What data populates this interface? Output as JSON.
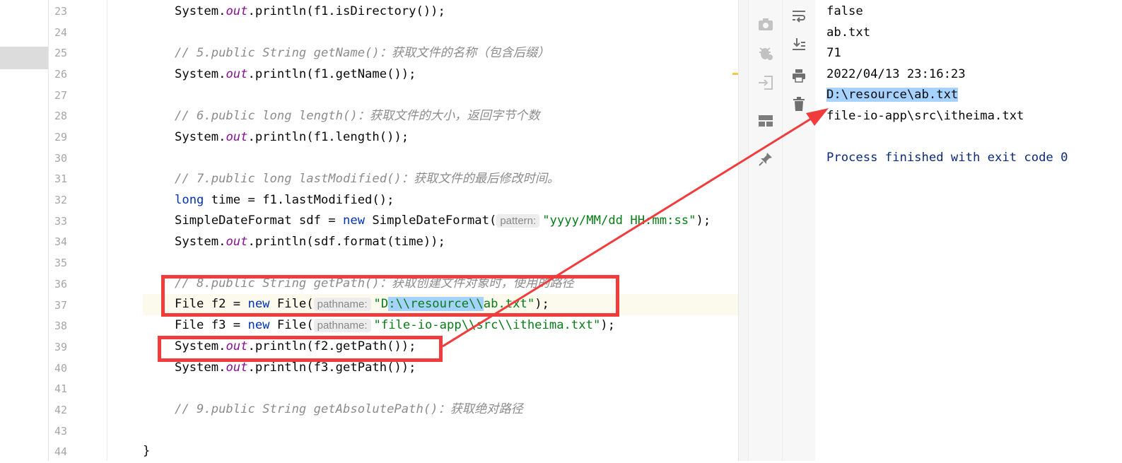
{
  "gutter": {
    "line_numbers": [
      "23",
      "24",
      "25",
      "26",
      "27",
      "28",
      "29",
      "30",
      "31",
      "32",
      "33",
      "34",
      "35",
      "36",
      "37",
      "38",
      "39",
      "40",
      "41",
      "42",
      "43",
      "44"
    ]
  },
  "code": {
    "l23": {
      "a": "System.",
      "b": "out",
      ".c": "",
      "c": ".println(f1.isDirectory());"
    },
    "l25": {
      "text": "// 5.public String getName()：获取文件的名称（包含后缀）"
    },
    "l26": {
      "a": "System.",
      "b": "out",
      "c": ".println(f1.getName());"
    },
    "l28": {
      "text": "// 6.public long length()：获取文件的大小，返回字节个数"
    },
    "l29": {
      "a": "System.",
      "b": "out",
      "c": ".println(f1.length());"
    },
    "l31": {
      "text": "// 7.public long lastModified()：获取文件的最后修改时间。"
    },
    "l32": {
      "kw": "long",
      "rest": " time = f1.lastModified();"
    },
    "l33": {
      "a": "SimpleDateFormat sdf = ",
      "kw": "new",
      "b": " SimpleDateFormat(",
      "hint": "pattern:",
      "str": "\"yyyy/MM/dd HH:mm:ss\"",
      "c": ");"
    },
    "l34": {
      "a": "System.",
      "b": "out",
      "c": ".println(sdf.format(time));"
    },
    "l36": {
      "text": "// 8.public String getPath()：获取创建文件对象时，使用的路径"
    },
    "l37": {
      "a": "File f2 = ",
      "kw": "new",
      "b": " File(",
      "hint": "pathname:",
      "str_a": "\"D",
      "str_sel": ":\\\\resource\\\\",
      "str_b": "ab.txt\"",
      "c": ");"
    },
    "l38": {
      "a": "File f3 = ",
      "kw": "new",
      "b": " File(",
      "hint": "pathname:",
      "str": "\"file-io-app\\\\src\\\\itheima.txt\"",
      "c": ");"
    },
    "l39": {
      "a": "System.",
      "b": "out",
      "c": ".println(f2.getPath());"
    },
    "l40": {
      "a": "System.",
      "b": "out",
      "c": ".println(f3.getPath());"
    },
    "l42": {
      "text": "// 9.public String getAbsolutePath()：获取绝对路径"
    },
    "l44": {
      "text": "}"
    }
  },
  "console": {
    "lines": [
      "false",
      "ab.txt",
      "71",
      "2022/04/13 23:16:23",
      "D:\\resource\\ab.txt",
      "file-io-app\\src\\itheima.txt",
      "",
      "Process finished with exit code 0"
    ]
  },
  "icons": {
    "toolbar_left": [
      "camera-icon",
      "debug-icon",
      "login-icon",
      "layout-icon",
      "pin-icon"
    ],
    "toolbar_right": [
      "soft-wrap-icon",
      "scroll-to-end-icon",
      "print-icon",
      "trash-icon"
    ],
    "gutter": [
      "lightbulb-icon"
    ]
  },
  "colors": {
    "keyword": "#0033b3",
    "field": "#871094",
    "string": "#067d17",
    "comment": "#8c8c8c",
    "annotation_red": "#f03c3c",
    "selection": "#a6d2ff"
  }
}
